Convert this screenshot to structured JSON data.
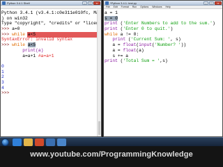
{
  "shell_window": {
    "title": "Python 3.4.1 Shell",
    "lines": [
      {
        "parts": [
          {
            "t": "Python 3.4.1 (v3.4.1:c0e311e010fc, May",
            "c": "blk"
          }
        ]
      },
      {
        "parts": [
          {
            "t": ") on win32",
            "c": "blk"
          }
        ]
      },
      {
        "parts": [
          {
            "t": "Type \"copyright\", \"credits\" or \"license",
            "c": "blk"
          }
        ]
      },
      {
        "parts": [
          {
            "t": ">>> ",
            "c": "prompt"
          },
          {
            "t": "a=0",
            "c": "blk"
          }
        ]
      },
      {
        "parts": [
          {
            "t": ">>> ",
            "c": "prompt"
          },
          {
            "t": "while",
            "c": "kw"
          },
          {
            "t": " a<5",
            "c": "blk"
          }
        ],
        "highlight": "red"
      },
      {
        "parts": [
          {
            "t": "SyntaxError: invalid syntax",
            "c": "err"
          }
        ]
      },
      {
        "parts": [
          {
            "t": ">>> ",
            "c": "prompt"
          },
          {
            "t": "while",
            "c": "kw"
          },
          {
            "t": " ",
            "c": "blk"
          },
          {
            "t": "a<5",
            "c": "sel"
          }
        ]
      },
      {
        "parts": [
          {
            "t": "        print(a)",
            "c": "pur"
          }
        ]
      },
      {
        "parts": [
          {
            "t": "        a=a+1 ",
            "c": "blk"
          },
          {
            "t": "#a=a+1",
            "c": "err"
          }
        ]
      },
      {
        "parts": [
          {
            "t": "",
            "c": "blk"
          }
        ]
      },
      {
        "parts": [
          {
            "t": "0",
            "c": "out"
          }
        ]
      },
      {
        "parts": [
          {
            "t": "1",
            "c": "out"
          }
        ]
      },
      {
        "parts": [
          {
            "t": "2",
            "c": "out"
          }
        ]
      },
      {
        "parts": [
          {
            "t": "3",
            "c": "out"
          }
        ]
      },
      {
        "parts": [
          {
            "t": "4",
            "c": "out"
          }
        ]
      },
      {
        "parts": [
          {
            "t": ">>> ",
            "c": "prompt"
          }
        ]
      }
    ]
  },
  "editor_window": {
    "title": "*Python 3.4.1: test.py",
    "menu": [
      "File",
      "Edit",
      "Format",
      "Run",
      "Options",
      "Windows",
      "Help"
    ],
    "lines": [
      {
        "parts": [
          {
            "t": "a = 1",
            "c": "blk"
          }
        ]
      },
      {
        "parts": [
          {
            "t": "s = 0",
            "c": "sel"
          }
        ]
      },
      {
        "parts": [
          {
            "t": "print",
            "c": "pur"
          },
          {
            "t": " (",
            "c": "blk"
          },
          {
            "t": "'Enter Numbers to add to the sum.'",
            "c": "str"
          },
          {
            "t": ")",
            "c": "blk"
          }
        ]
      },
      {
        "parts": [
          {
            "t": "print",
            "c": "pur"
          },
          {
            "t": " (",
            "c": "blk"
          },
          {
            "t": "'Enter 0 to quit.'",
            "c": "str"
          },
          {
            "t": ")",
            "c": "blk"
          }
        ]
      },
      {
        "parts": [
          {
            "t": "while",
            "c": "kw"
          },
          {
            "t": " a != 0:",
            "c": "blk"
          }
        ]
      },
      {
        "parts": [
          {
            "t": "   print",
            "c": "pur"
          },
          {
            "t": " (",
            "c": "blk"
          },
          {
            "t": "'Current Sum: '",
            "c": "str"
          },
          {
            "t": ", s)",
            "c": "blk"
          }
        ]
      },
      {
        "parts": [
          {
            "t": "   a = ",
            "c": "blk"
          },
          {
            "t": "float",
            "c": "pur"
          },
          {
            "t": "(",
            "c": "blk"
          },
          {
            "t": "input",
            "c": "pur"
          },
          {
            "t": "(",
            "c": "blk"
          },
          {
            "t": "'Number? '",
            "c": "str"
          },
          {
            "t": "))",
            "c": "blk"
          }
        ]
      },
      {
        "parts": [
          {
            "t": "   a = ",
            "c": "blk"
          },
          {
            "t": "float",
            "c": "pur"
          },
          {
            "t": "(a)",
            "c": "blk"
          }
        ]
      },
      {
        "parts": [
          {
            "t": "   s += a",
            "c": "blk"
          }
        ]
      },
      {
        "parts": [
          {
            "t": "print",
            "c": "pur"
          },
          {
            "t": " (",
            "c": "blk"
          },
          {
            "t": "'Total Sum = '",
            "c": "str"
          },
          {
            "t": ",s)",
            "c": "blk"
          }
        ]
      }
    ]
  },
  "taskbar": {
    "clock": "",
    "items": [
      {
        "icon": "ie-icon",
        "color": "#2f7fd8"
      },
      {
        "icon": "folder-icon",
        "color": "#e2b54a"
      },
      {
        "icon": "media-icon",
        "color": "#d04a2a"
      },
      {
        "icon": "python-icon",
        "color": "#3a6fb0"
      },
      {
        "icon": "python-shell-icon",
        "color": "#4a85c9"
      }
    ]
  },
  "footer": {
    "url": "www.youtube.com/ProgrammingKnowledge"
  }
}
